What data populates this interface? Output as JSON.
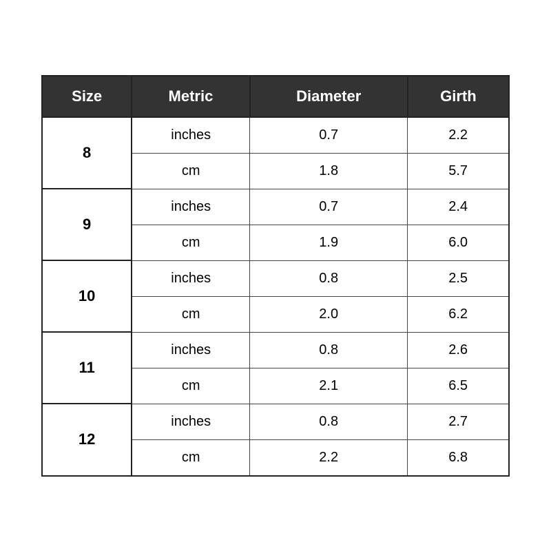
{
  "table": {
    "headers": [
      "Size",
      "Metric",
      "Diameter",
      "Girth"
    ],
    "rows": [
      {
        "size": "8",
        "data": [
          {
            "metric": "inches",
            "diameter": "0.7",
            "girth": "2.2"
          },
          {
            "metric": "cm",
            "diameter": "1.8",
            "girth": "5.7"
          }
        ]
      },
      {
        "size": "9",
        "data": [
          {
            "metric": "inches",
            "diameter": "0.7",
            "girth": "2.4"
          },
          {
            "metric": "cm",
            "diameter": "1.9",
            "girth": "6.0"
          }
        ]
      },
      {
        "size": "10",
        "data": [
          {
            "metric": "inches",
            "diameter": "0.8",
            "girth": "2.5"
          },
          {
            "metric": "cm",
            "diameter": "2.0",
            "girth": "6.2"
          }
        ]
      },
      {
        "size": "11",
        "data": [
          {
            "metric": "inches",
            "diameter": "0.8",
            "girth": "2.6"
          },
          {
            "metric": "cm",
            "diameter": "2.1",
            "girth": "6.5"
          }
        ]
      },
      {
        "size": "12",
        "data": [
          {
            "metric": "inches",
            "diameter": "0.8",
            "girth": "2.7"
          },
          {
            "metric": "cm",
            "diameter": "2.2",
            "girth": "6.8"
          }
        ]
      }
    ]
  }
}
